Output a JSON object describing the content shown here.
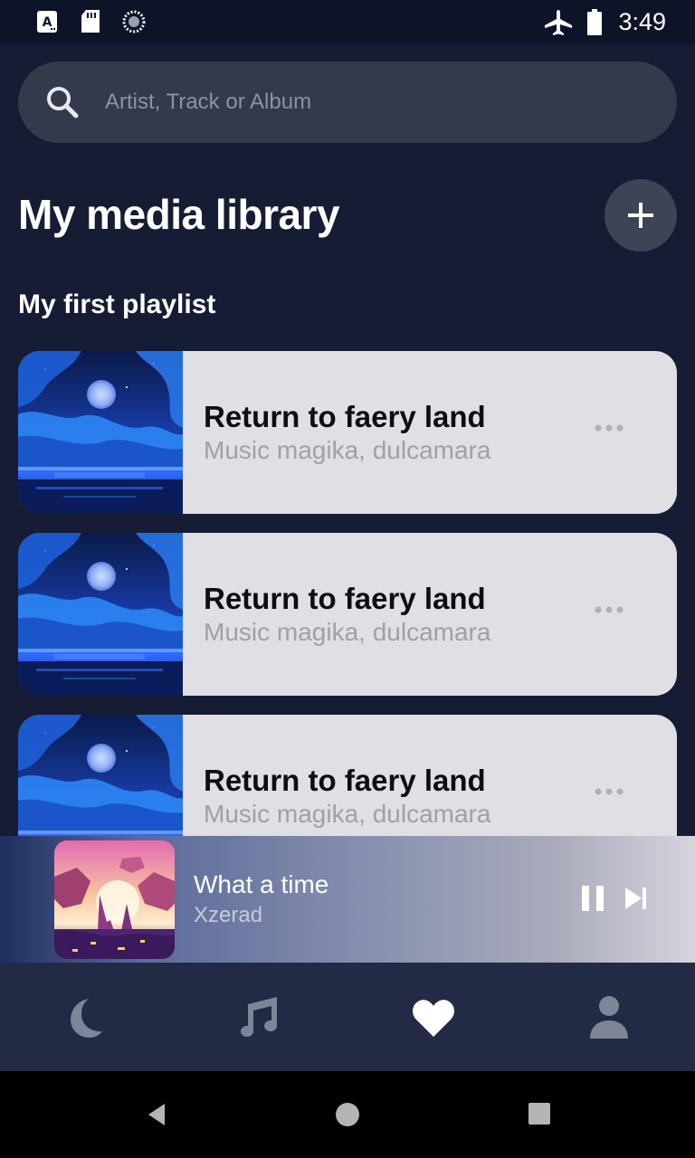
{
  "status_bar": {
    "time": "3:49"
  },
  "search": {
    "placeholder": "Artist, Track or Album",
    "value": ""
  },
  "header": {
    "title": "My media library",
    "add_icon": "plus-icon"
  },
  "playlist": {
    "title": "My first playlist",
    "tracks": [
      {
        "title": "Return to faery land",
        "artist": "Music magika, dulcamara"
      },
      {
        "title": "Return to faery land",
        "artist": "Music magika, dulcamara"
      },
      {
        "title": "Return to faery land",
        "artist": "Music magika, dulcamara"
      }
    ]
  },
  "now_playing": {
    "title": "What a time",
    "artist": "Xzerad",
    "state": "playing"
  },
  "tabs": [
    {
      "icon": "moon-icon",
      "active": false
    },
    {
      "icon": "music-note-icon",
      "active": false
    },
    {
      "icon": "heart-icon",
      "active": true
    },
    {
      "icon": "person-icon",
      "active": false
    }
  ],
  "colors": {
    "background": "#151c33",
    "card": "#dfdfe4",
    "tab_active": "#ffffff",
    "tab_inactive": "#7e8596"
  }
}
